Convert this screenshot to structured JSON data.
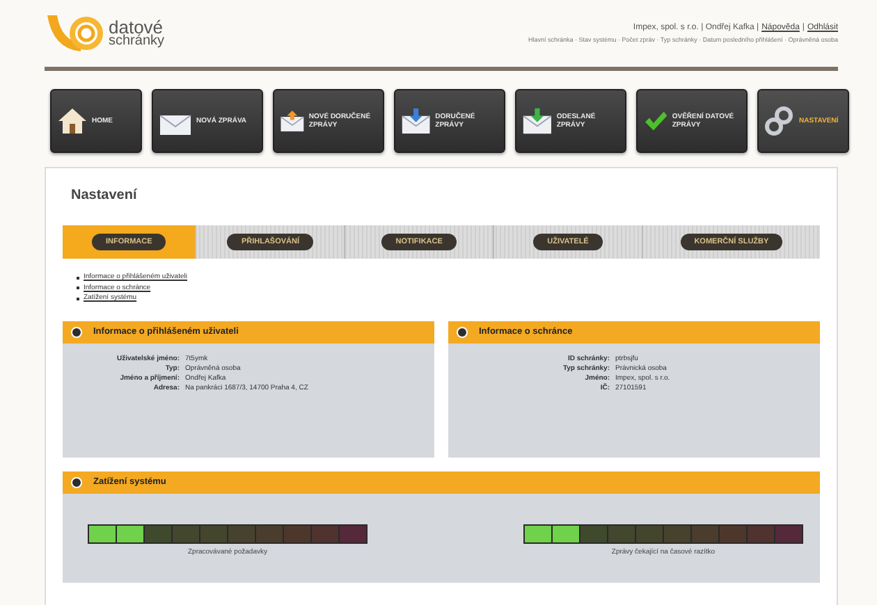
{
  "header": {
    "logo_line1": "datové",
    "logo_line2": "schránky",
    "account": "Impex, spol. s r.o. | Ondřej Kafka |",
    "links": [
      "Nápověda",
      "Odhlásit"
    ],
    "link_separator": "|",
    "subline": "Hlavní schránka · Stav systému · Počet zpráv · Typ schránky · Datum posledního přihlášení · Oprávněná osoba"
  },
  "nav": [
    {
      "label": "HOME",
      "kind": "home",
      "selected": false
    },
    {
      "label": "NOVÁ ZPRÁVA",
      "kind": "compose",
      "selected": false
    },
    {
      "label": "NOVÉ DORUČENÉ ZPRÁVY",
      "kind": "new",
      "selected": false
    },
    {
      "label": "DORUČENÉ ZPRÁVY",
      "kind": "inbox",
      "selected": false
    },
    {
      "label": "ODESLANÉ ZPRÁVY",
      "kind": "sent",
      "selected": false
    },
    {
      "label": "OVĚŘENÍ DATOVÉ ZPRÁVY",
      "kind": "verify",
      "selected": false
    },
    {
      "label": "NASTAVENÍ",
      "kind": "settings",
      "selected": true
    }
  ],
  "page_title": "Nastavení",
  "tabs": [
    {
      "label": "INFORMACE",
      "selected": true
    },
    {
      "label": "PŘIHLAŠOVÁNÍ",
      "selected": false
    },
    {
      "label": "NOTIFIKACE",
      "selected": false
    },
    {
      "label": "UŽIVATELÉ",
      "selected": false
    },
    {
      "label": "KOMERČNÍ SLUŽBY",
      "selected": false
    }
  ],
  "links": [
    "Informace o přihlášeném uživateli",
    "Informace o schránce",
    "Zatížení systému"
  ],
  "panels": [
    {
      "title": "Informace o přihlášeném uživateli",
      "fields": [
        {
          "label": "Uživatelské jméno:",
          "value": "7t5ymk"
        },
        {
          "label": "Typ:",
          "value": "Oprávněná osoba"
        },
        {
          "label": "Jméno a příjmení:",
          "value": "Ondřej Kafka"
        },
        {
          "label": "Adresa:",
          "value": "Na pankráci 1687/3, 14700 Praha 4, CZ"
        }
      ]
    },
    {
      "title": "Informace o schránce",
      "fields": [
        {
          "label": "ID schránky:",
          "value": "ptrbsjfu"
        },
        {
          "label": "Typ schránky:",
          "value": "Právnická osoba"
        },
        {
          "label": "Jméno:",
          "value": "Impex, spol. s r.o."
        },
        {
          "label": "IČ:",
          "value": "27101591"
        }
      ]
    }
  ],
  "load_panel": {
    "title": "Zatížení systému",
    "meters": [
      {
        "label": "Zpracovávané požadavky",
        "level": 0.2
      },
      {
        "label": "Zprávy čekající na časové razítko",
        "level": 0.2
      }
    ]
  }
}
